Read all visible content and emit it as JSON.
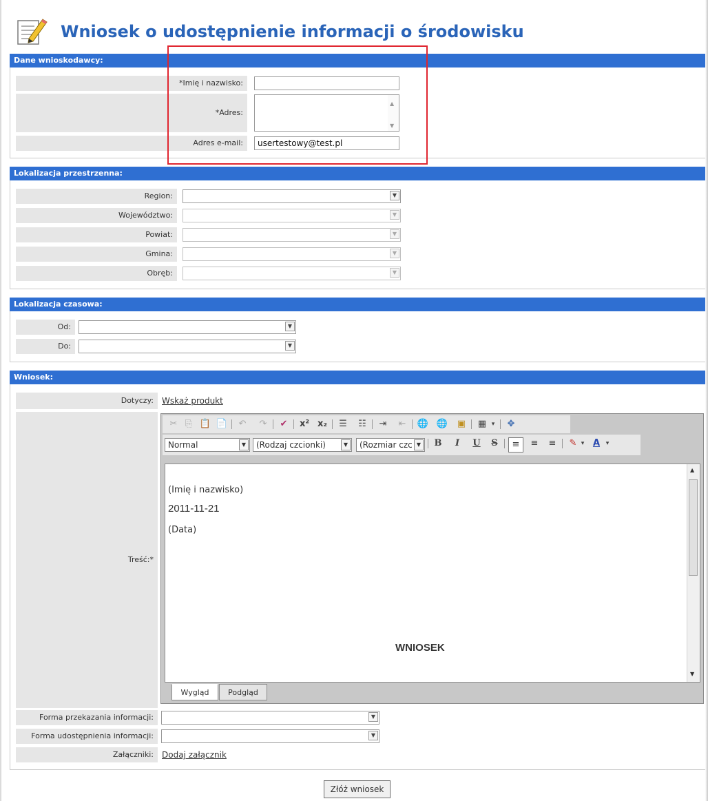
{
  "header": {
    "title": "Wniosek o udostępnienie informacji o środowisku",
    "icon": "edit-document-icon"
  },
  "applicant": {
    "section_title": "Dane wnioskodawcy:",
    "name_label": "*Imię i nazwisko:",
    "name_value": "",
    "address_label": "*Adres:",
    "address_value": "",
    "email_label": "Adres e-mail:",
    "email_value": "usertestowy@test.pl"
  },
  "location": {
    "section_title": "Lokalizacja przestrzenna:",
    "region_label": "Region:",
    "voivodeship_label": "Województwo:",
    "county_label": "Powiat:",
    "commune_label": "Gmina:",
    "precinct_label": "Obręb:"
  },
  "time": {
    "section_title": "Lokalizacja czasowa:",
    "from_label": "Od:",
    "to_label": "Do:"
  },
  "request": {
    "section_title": "Wniosek:",
    "concerns_label": "Dotyczy:",
    "concerns_link": "Wskaż produkt",
    "content_label": "Treść:*",
    "delivery_label": "Forma przekazania informacji:",
    "sharing_label": "Forma udostępnienia informacji:",
    "attachments_label": "Załączniki:",
    "attachments_link": "Dodaj załącznik"
  },
  "editor": {
    "format_value": "Normal",
    "font_value": "(Rodzaj czcionki)",
    "size_value": "(Rozmiar czc",
    "line1": "(Imię i nazwisko)",
    "line2": "2011-11-21",
    "line3": "(Data)",
    "heading": "WNIOSEK",
    "tab_design": "Wygląd",
    "tab_preview": "Podgląd",
    "bold": "B",
    "italic": "I",
    "underline": "U",
    "strike": "S",
    "font_color": "A",
    "superscript": "x²",
    "subscript": "x₂"
  },
  "submit_label": "Złóż wniosek",
  "colors": {
    "section_bar": "#2f6fd2",
    "title": "#2a64b8",
    "highlight": "#e0252f",
    "label_bg": "#e6e6e6"
  }
}
